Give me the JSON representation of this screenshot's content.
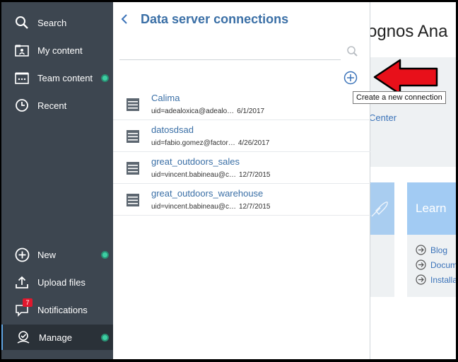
{
  "sidebar": {
    "items": [
      {
        "label": "Search"
      },
      {
        "label": "My content"
      },
      {
        "label": "Team content"
      },
      {
        "label": "Recent"
      },
      {
        "label": "New"
      },
      {
        "label": "Upload files"
      },
      {
        "label": "Notifications",
        "badge": "7"
      },
      {
        "label": "Manage"
      }
    ]
  },
  "panel": {
    "title": "Data server connections",
    "search": {
      "value": "",
      "placeholder": ""
    },
    "add_tooltip": "Create a new connection",
    "connections": [
      {
        "name": "Calima",
        "uid": "uid=adealoxica@adealo…",
        "date": "6/1/2017"
      },
      {
        "name": "datosdsad",
        "uid": "uid=fabio.gomez@factor…",
        "date": "4/26/2017"
      },
      {
        "name": "great_outdoors_sales",
        "uid": "uid=vincent.babineau@c…",
        "date": "12/7/2015"
      },
      {
        "name": "great_outdoors_warehouse",
        "uid": "uid=vincent.babineau@c…",
        "date": "12/7/2015"
      }
    ]
  },
  "background": {
    "title": "ognos Ana",
    "center_link": "Center",
    "learn": {
      "title": "Learn",
      "links": [
        "Blog",
        "Docum",
        "Installa"
      ]
    }
  },
  "colors": {
    "sidebar": "#3d4650",
    "accent": "#3a6fa6",
    "status_dot": "#3dcfa3",
    "annotation_arrow": "#e8101a"
  }
}
